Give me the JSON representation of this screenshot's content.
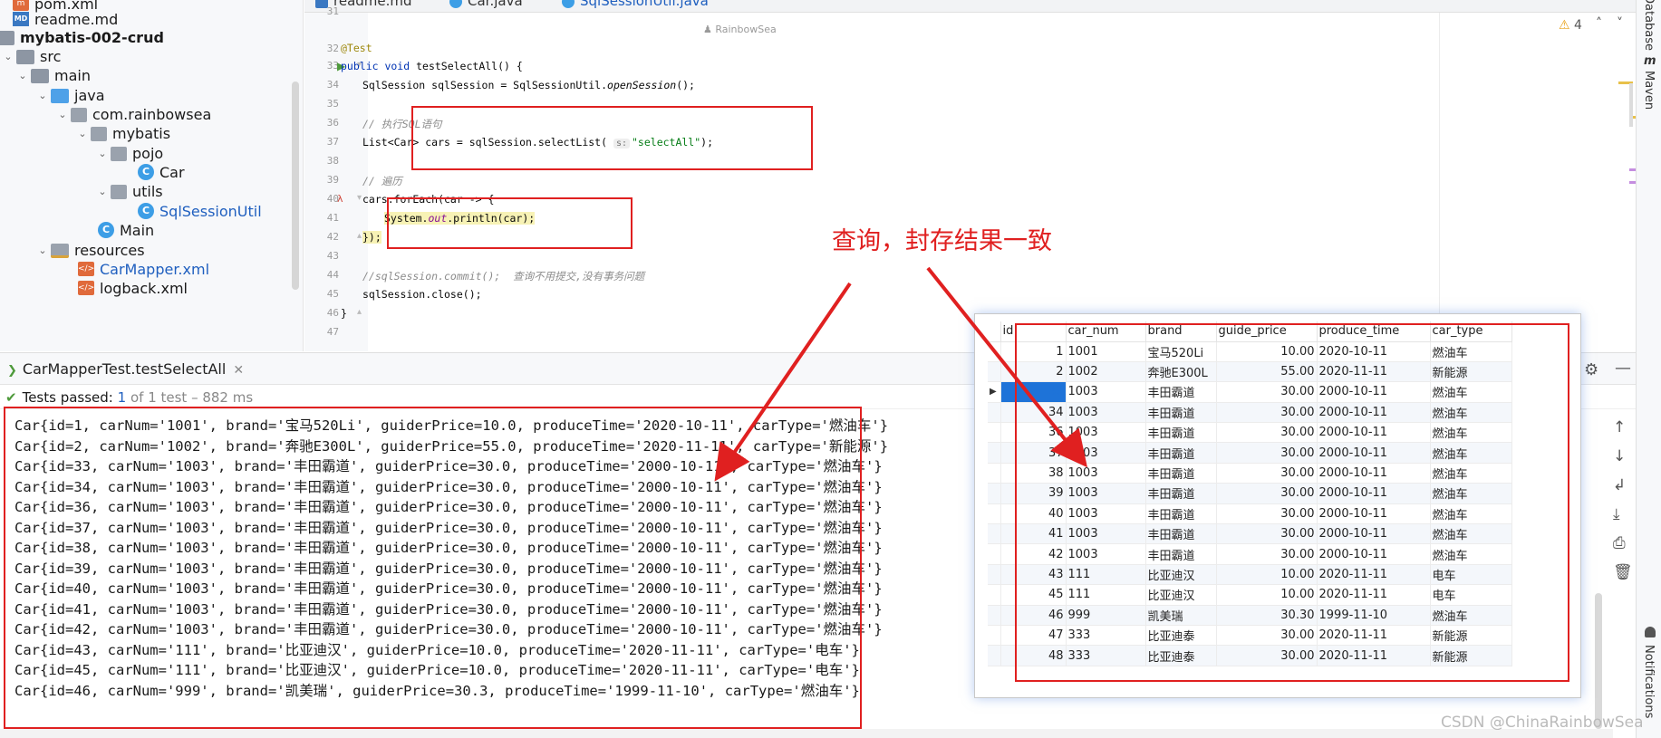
{
  "colors": {
    "accent": "#e02020",
    "selection": "#1e73d8",
    "pass": "#4e9a3b"
  },
  "tree": {
    "items": [
      {
        "label": "pom.xml",
        "icon": "xml-file-icon"
      },
      {
        "label": "readme.md",
        "icon": "markdown-file-icon"
      },
      {
        "label": "mybatis-002-crud",
        "icon": "module-folder-icon"
      },
      {
        "label": "src",
        "icon": "folder-icon"
      },
      {
        "label": "main",
        "icon": "folder-icon"
      },
      {
        "label": "java",
        "icon": "source-folder-icon"
      },
      {
        "label": "com.rainbowsea",
        "icon": "package-icon"
      },
      {
        "label": "mybatis",
        "icon": "package-icon"
      },
      {
        "label": "pojo",
        "icon": "package-icon"
      },
      {
        "label": "Car",
        "icon": "class-icon"
      },
      {
        "label": "utils",
        "icon": "package-icon"
      },
      {
        "label": "SqlSessionUtil",
        "icon": "class-icon"
      },
      {
        "label": "Main",
        "icon": "class-icon"
      },
      {
        "label": "resources",
        "icon": "resources-folder-icon"
      },
      {
        "label": "CarMapper.xml",
        "icon": "mybatis-xml-icon"
      },
      {
        "label": "logback.xml",
        "icon": "xml-file-icon"
      }
    ]
  },
  "editor": {
    "tabs": [
      "readme.md",
      "Car.java",
      "SqlSessionUtil.java"
    ],
    "author": "RainbowSea",
    "line_numbers": [
      "31",
      "32",
      "33",
      "34",
      "35",
      "36",
      "37",
      "38",
      "39",
      "40",
      "41",
      "42",
      "43",
      "44",
      "45",
      "46",
      "47"
    ],
    "code": {
      "l32": "@Test",
      "l33_kw": "public void",
      "l33_rest": " testSelectAll() {",
      "l34_a": "SqlSession sqlSession = SqlSessionUtil.",
      "l34_b": "openSession",
      "l34_c": "();",
      "l36": "// 执行SQL语句",
      "l37_a": "List<Car> cars = sqlSession.selectList( ",
      "l37_hint": "s:",
      "l37_str": "\"selectAll\"",
      "l37_c": ");",
      "l39": "// 遍历",
      "l40": "cars.forEach(car -> {",
      "l41_a": "System.",
      "l41_b": "out",
      "l41_c": ".println(car);",
      "l42": "});",
      "l44_a": "//sqlSession.commit();",
      "l44_b": "  查询不用提交,没有事务问题",
      "l45": "sqlSession.close();",
      "l46": "}"
    },
    "warning_count": "4"
  },
  "right_strip": {
    "database": "Database",
    "maven": "Maven",
    "maven_icon": "m",
    "notifications": "Notifications"
  },
  "run": {
    "tab_label": "CarMapperTest.testSelectAll",
    "status_passed": "Tests passed:",
    "status_count": "1",
    "status_rest": "of 1 test – 882 ms",
    "lines": [
      "Car{id=1, carNum='1001', brand='宝马520Li', guiderPrice=10.0, produceTime='2020-10-11', carType='燃油车'}",
      "Car{id=2, carNum='1002', brand='奔驰E300L', guiderPrice=55.0, produceTime='2020-11-11', carType='新能源'}",
      "Car{id=33, carNum='1003', brand='丰田霸道', guiderPrice=30.0, produceTime='2000-10-11', carType='燃油车'}",
      "Car{id=34, carNum='1003', brand='丰田霸道', guiderPrice=30.0, produceTime='2000-10-11', carType='燃油车'}",
      "Car{id=36, carNum='1003', brand='丰田霸道', guiderPrice=30.0, produceTime='2000-10-11', carType='燃油车'}",
      "Car{id=37, carNum='1003', brand='丰田霸道', guiderPrice=30.0, produceTime='2000-10-11', carType='燃油车'}",
      "Car{id=38, carNum='1003', brand='丰田霸道', guiderPrice=30.0, produceTime='2000-10-11', carType='燃油车'}",
      "Car{id=39, carNum='1003', brand='丰田霸道', guiderPrice=30.0, produceTime='2000-10-11', carType='燃油车'}",
      "Car{id=40, carNum='1003', brand='丰田霸道', guiderPrice=30.0, produceTime='2000-10-11', carType='燃油车'}",
      "Car{id=41, carNum='1003', brand='丰田霸道', guiderPrice=30.0, produceTime='2000-10-11', carType='燃油车'}",
      "Car{id=42, carNum='1003', brand='丰田霸道', guiderPrice=30.0, produceTime='2000-10-11', carType='燃油车'}",
      "Car{id=43, carNum='111', brand='比亚迪汉', guiderPrice=10.0, produceTime='2020-11-11', carType='电车'}",
      "Car{id=45, carNum='111', brand='比亚迪汉', guiderPrice=10.0, produceTime='2020-11-11', carType='电车'}",
      "Car{id=46, carNum='999', brand='凯美瑞', guiderPrice=30.3, produceTime='1999-11-10', carType='燃油车'}"
    ]
  },
  "db": {
    "columns": [
      "id",
      "car_num",
      "brand",
      "guide_price",
      "produce_time",
      "car_type"
    ],
    "rows": [
      [
        "1",
        "1001",
        "宝马520Li",
        "10.00",
        "2020-10-11",
        "燃油车"
      ],
      [
        "2",
        "1002",
        "奔驰E300L",
        "55.00",
        "2020-11-11",
        "新能源"
      ],
      [
        "33",
        "1003",
        "丰田霸道",
        "30.00",
        "2000-10-11",
        "燃油车"
      ],
      [
        "34",
        "1003",
        "丰田霸道",
        "30.00",
        "2000-10-11",
        "燃油车"
      ],
      [
        "36",
        "1003",
        "丰田霸道",
        "30.00",
        "2000-10-11",
        "燃油车"
      ],
      [
        "37",
        "1003",
        "丰田霸道",
        "30.00",
        "2000-10-11",
        "燃油车"
      ],
      [
        "38",
        "1003",
        "丰田霸道",
        "30.00",
        "2000-10-11",
        "燃油车"
      ],
      [
        "39",
        "1003",
        "丰田霸道",
        "30.00",
        "2000-10-11",
        "燃油车"
      ],
      [
        "40",
        "1003",
        "丰田霸道",
        "30.00",
        "2000-10-11",
        "燃油车"
      ],
      [
        "41",
        "1003",
        "丰田霸道",
        "30.00",
        "2000-10-11",
        "燃油车"
      ],
      [
        "42",
        "1003",
        "丰田霸道",
        "30.00",
        "2000-10-11",
        "燃油车"
      ],
      [
        "43",
        "111",
        "比亚迪汉",
        "10.00",
        "2020-11-11",
        "电车"
      ],
      [
        "45",
        "111",
        "比亚迪汉",
        "10.00",
        "2020-11-11",
        "电车"
      ],
      [
        "46",
        "999",
        "凯美瑞",
        "30.30",
        "1999-11-10",
        "燃油车"
      ],
      [
        "47",
        "333",
        "比亚迪泰",
        "30.00",
        "2020-11-11",
        "新能源"
      ],
      [
        "48",
        "333",
        "比亚迪泰",
        "30.00",
        "2020-11-11",
        "新能源"
      ]
    ],
    "selected_row": 2
  },
  "callout": "查询，封存结果一致",
  "watermark": "CSDN @ChinaRainbowSea"
}
